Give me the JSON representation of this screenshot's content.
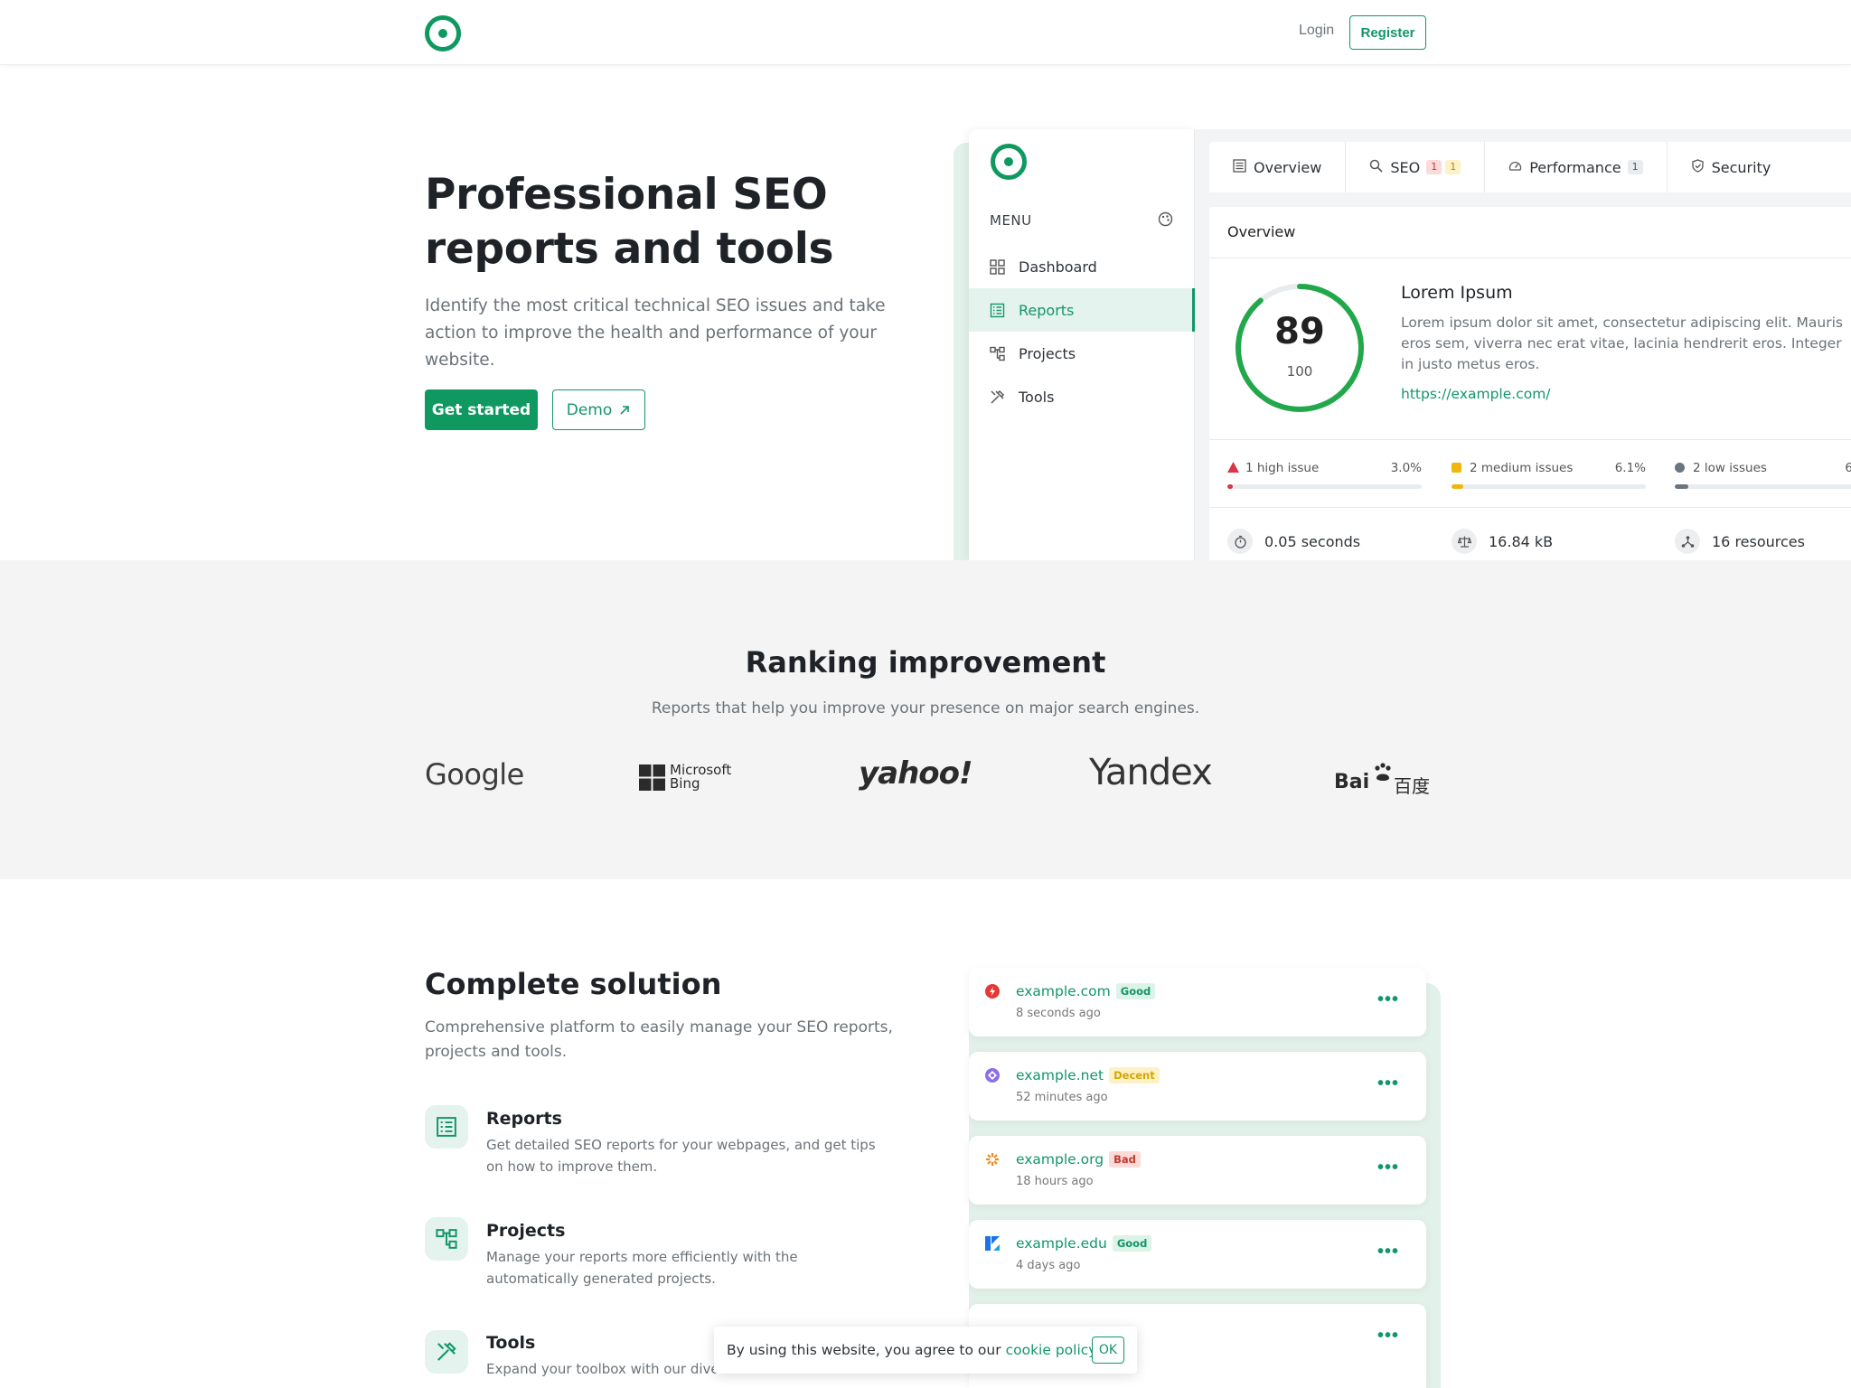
{
  "nav": {
    "login": "Login",
    "register": "Register",
    "brand_color": "#0f9961"
  },
  "hero": {
    "title": "Professional SEO reports and tools",
    "subtitle": "Identify the most critical technical SEO issues and take action to improve the health and performance of your website.",
    "get_started": "Get started",
    "demo": "Demo",
    "demo_icon": "arrow-up-right-icon"
  },
  "app": {
    "menu_label": "MENU",
    "menu": [
      {
        "label": "Dashboard",
        "icon": "grid-icon"
      },
      {
        "label": "Reports",
        "icon": "report-icon",
        "active": true
      },
      {
        "label": "Projects",
        "icon": "projects-icon"
      },
      {
        "label": "Tools",
        "icon": "tools-icon"
      }
    ],
    "tabs": [
      {
        "label": "Overview",
        "icon": "list-icon"
      },
      {
        "label": "SEO",
        "icon": "search-icon",
        "badges": [
          "1",
          "1"
        ]
      },
      {
        "label": "Performance",
        "icon": "speed-icon",
        "badges": [
          "1"
        ]
      },
      {
        "label": "Security",
        "icon": "shield-icon"
      }
    ],
    "panel_title": "Overview",
    "score": "89",
    "score_max": "100",
    "score_fraction": 0.89,
    "site_title": "Lorem Ipsum",
    "site_desc": "Lorem ipsum dolor sit amet, consectetur adipiscing elit. Mauris eros sem, viverra nec erat vitae, lacinia hendrerit eros. Integer in justo metus eros.",
    "site_url": "https://example.com/",
    "issues": [
      {
        "label": "1 high issue",
        "pct": "3.0%",
        "fraction": 0.03,
        "color": "#dc3545"
      },
      {
        "label": "2 medium issues",
        "pct": "6.1%",
        "fraction": 0.061,
        "color": "#f0b70b"
      },
      {
        "label": "2 low issues",
        "pct": "6",
        "fraction": 0.061,
        "color": "#6c757d"
      }
    ],
    "stats": [
      {
        "label": "0.05 seconds",
        "icon": "stopwatch-icon"
      },
      {
        "label": "16.84 kB",
        "icon": "scale-icon"
      },
      {
        "label": "16 resources",
        "icon": "resources-icon"
      }
    ]
  },
  "ranking": {
    "title": "Ranking improvement",
    "subtitle": "Reports that help you improve your presence on major search engines.",
    "engines": [
      "Google",
      "Microsoft",
      "Bing",
      "yahoo!",
      "Yandex",
      "Bai",
      "百度"
    ]
  },
  "solution": {
    "title": "Complete solution",
    "subtitle": "Comprehensive platform to easily manage your SEO reports, projects and tools.",
    "features": [
      {
        "title": "Reports",
        "desc": "Get detailed SEO reports for your webpages, and get tips on how to improve them.",
        "icon": "report-icon"
      },
      {
        "title": "Projects",
        "desc": "Manage your reports more efficiently with the automatically generated projects.",
        "icon": "projects-icon"
      },
      {
        "title": "Tools",
        "desc": "Expand your toolbox with our divers",
        "icon": "tools-icon"
      }
    ],
    "sites": [
      {
        "domain": "example.com",
        "tag": "Good",
        "when": "8 seconds ago"
      },
      {
        "domain": "example.net",
        "tag": "Decent",
        "when": "52 minutes ago"
      },
      {
        "domain": "example.org",
        "tag": "Bad",
        "when": "18 hours ago"
      },
      {
        "domain": "example.edu",
        "tag": "Good",
        "when": "4 days ago"
      }
    ],
    "more": "•••"
  },
  "cookie": {
    "text": "By using this website, you agree to our",
    "link": "cookie policy.",
    "ok": "OK"
  }
}
